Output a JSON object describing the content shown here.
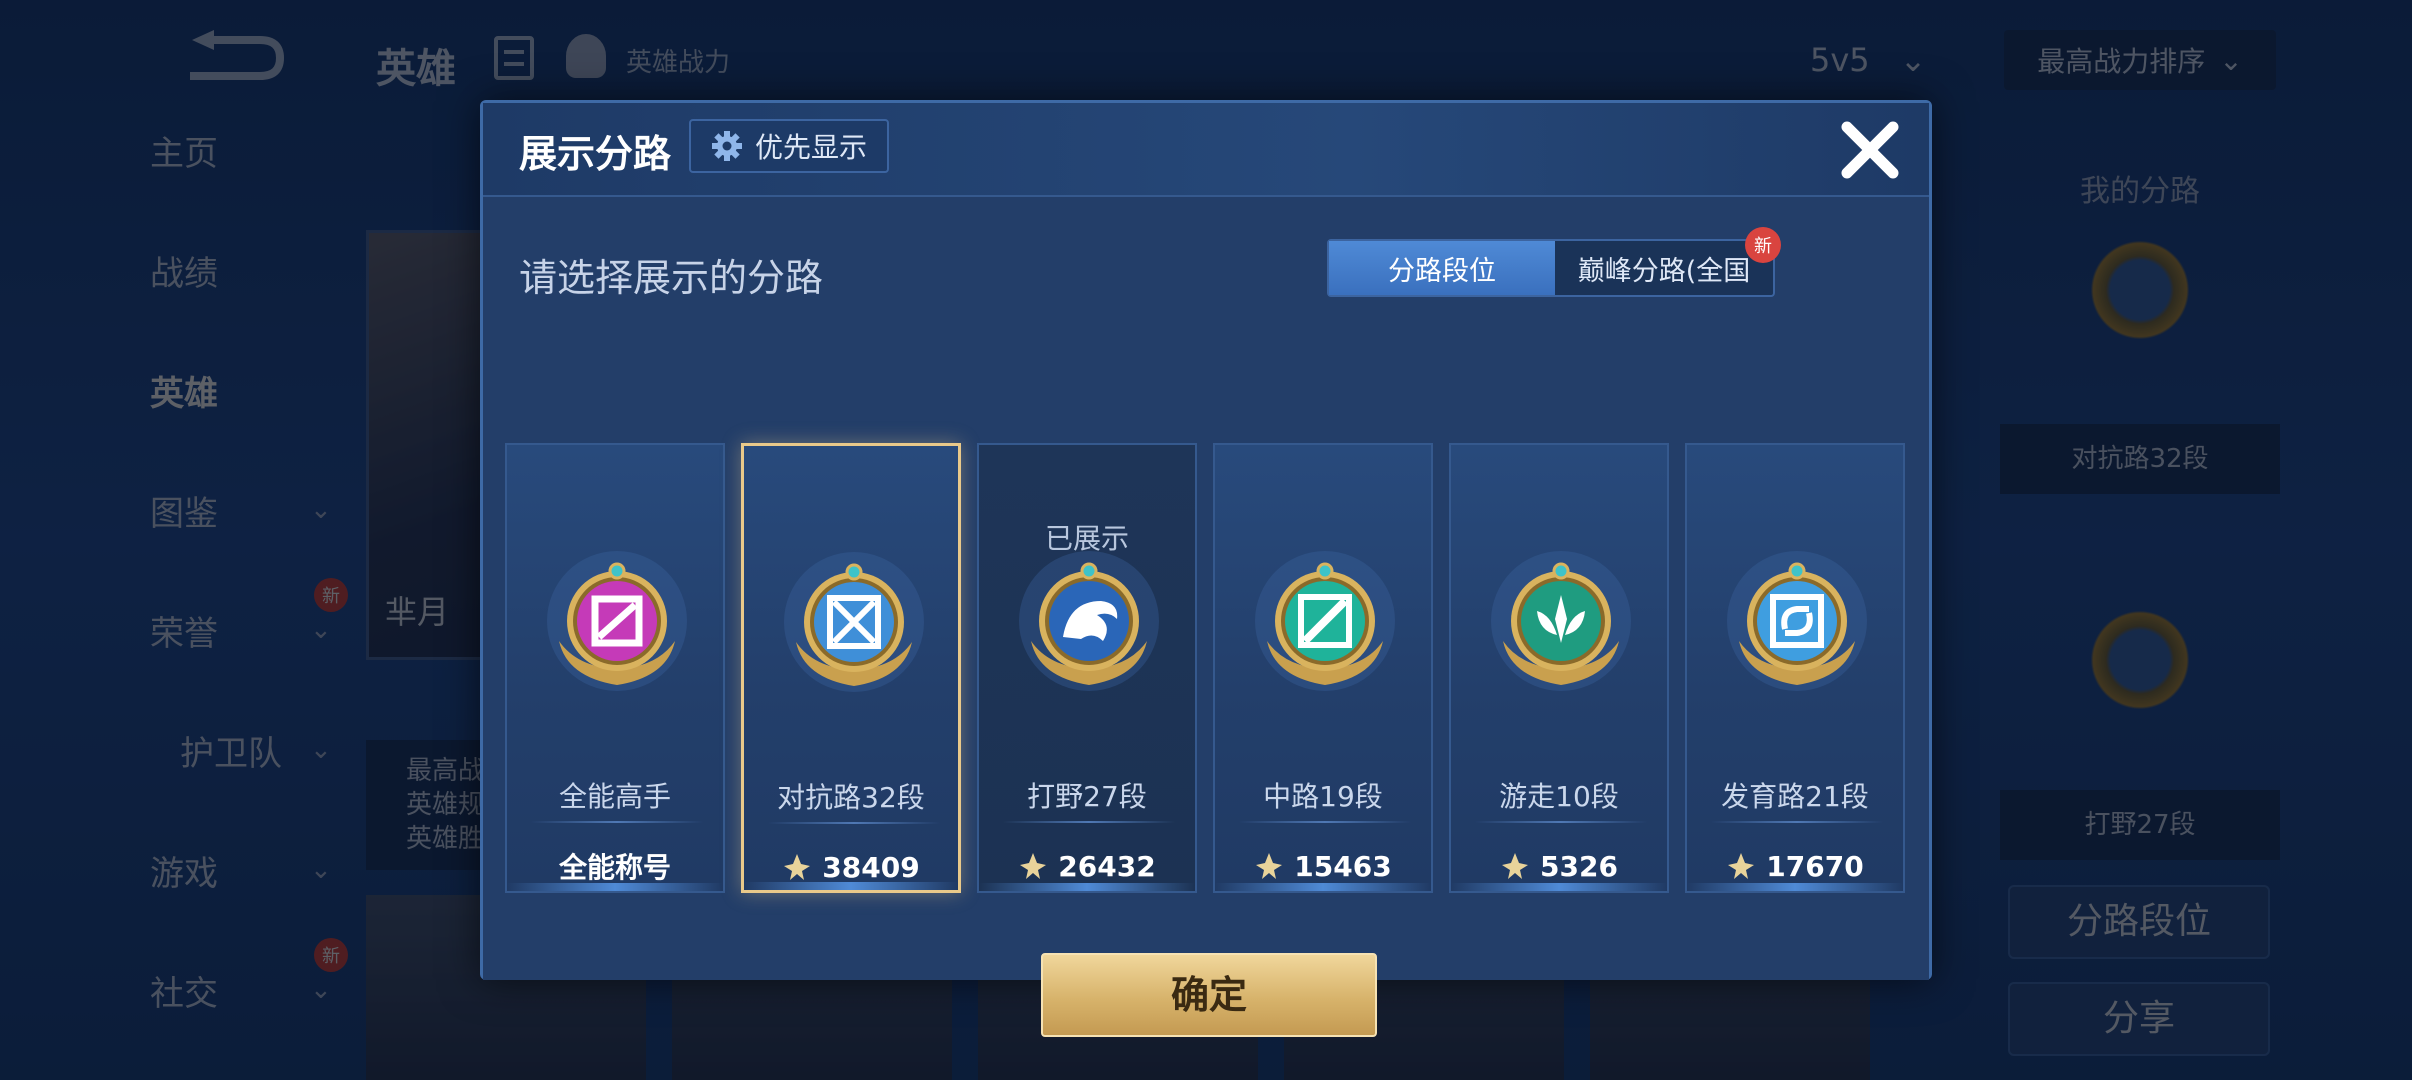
{
  "background": {
    "page_title": "英雄",
    "hero_power_label": "英雄战力",
    "mode_select": {
      "value": "5v5",
      "arrow": "⌄"
    },
    "sort_select": {
      "value": "最高战力排序",
      "arrow": "⌄"
    },
    "sidebar": [
      {
        "label": "主页",
        "chevron": false,
        "badge": ""
      },
      {
        "label": "战绩",
        "chevron": false,
        "badge": ""
      },
      {
        "label": "英雄",
        "chevron": false,
        "badge": "",
        "active": true
      },
      {
        "label": "图鉴",
        "chevron": true,
        "badge": ""
      },
      {
        "label": "荣誉",
        "chevron": true,
        "badge": "新"
      },
      {
        "label": "护卫队",
        "chevron": true,
        "badge": ""
      },
      {
        "label": "游戏",
        "chevron": true,
        "badge": ""
      },
      {
        "label": "社交",
        "chevron": true,
        "badge": "新"
      }
    ],
    "hero_card_name": "芈月",
    "hero_stats": [
      "最高战",
      "英雄规",
      "英雄胜"
    ],
    "right_panel": {
      "title": "我的分路",
      "first_label": "对抗路32段",
      "second_label": "打野27段",
      "lane_rank_button": "分路段位",
      "share_button": "分享"
    }
  },
  "modal": {
    "title": "展示分路",
    "priority_button": "优先显示",
    "prompt": "请选择展示的分路",
    "tabs": [
      {
        "label": "分路段位",
        "active": true
      },
      {
        "label": "巅峰分路(全国",
        "badge": "新"
      }
    ],
    "cards": [
      {
        "status": "",
        "role": "全能高手",
        "footer": "全能称号",
        "show_power": false,
        "emblem_color": "#c53ab8",
        "emblem_glyph": "allround"
      },
      {
        "status": "",
        "role": "对抗路32段",
        "footer": "38409",
        "show_power": true,
        "selected": true,
        "emblem_color": "#3f8fd8",
        "emblem_glyph": "clash"
      },
      {
        "status": "已展示",
        "role": "打野27段",
        "footer": "26432",
        "show_power": true,
        "emblem_color": "#2a66b8",
        "emblem_glyph": "jungle"
      },
      {
        "status": "",
        "role": "中路19段",
        "footer": "15463",
        "show_power": true,
        "emblem_color": "#1fb39a",
        "emblem_glyph": "mid"
      },
      {
        "status": "",
        "role": "游走10段",
        "footer": "5326",
        "show_power": true,
        "emblem_color": "#1f9c80",
        "emblem_glyph": "roam"
      },
      {
        "status": "",
        "role": "发育路21段",
        "footer": "17670",
        "show_power": true,
        "emblem_color": "#3f9ee0",
        "emblem_glyph": "farm"
      }
    ],
    "confirm_button": "确定"
  },
  "colors": {
    "accent_blue": "#3a70be",
    "selected_border": "#e9c98a",
    "confirm_gold": "#d7b36b",
    "badge_red": "#d9443f"
  },
  "icons": [
    "back-arrow-icon",
    "list-icon",
    "hero-power-icon",
    "gear-icon",
    "close-icon",
    "power-icon",
    "chevron-down-icon"
  ]
}
